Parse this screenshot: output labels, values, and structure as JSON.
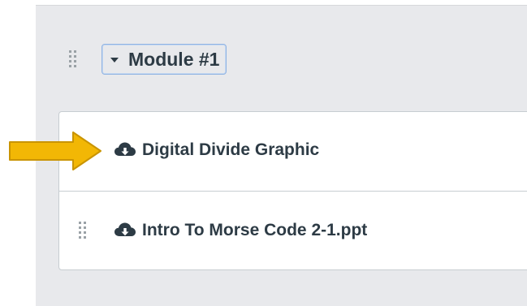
{
  "module": {
    "title": "Module #1",
    "toggle_icon": "caret-down-icon",
    "handle_icon": "drag-handle-icon"
  },
  "items": [
    {
      "label": "Digital Divide Graphic",
      "icon": "cloud-download-icon"
    },
    {
      "label": "Intro To Morse Code 2-1.ppt",
      "icon": "cloud-download-icon"
    }
  ],
  "annotation": {
    "icon": "arrow-right-icon",
    "color": "#f2b705",
    "outline": "#c99400"
  },
  "colors": {
    "panel_bg": "#e8e9ec",
    "text": "#2d3b45",
    "focus_border": "#8fb3e3",
    "item_border": "#c7cdd1"
  }
}
